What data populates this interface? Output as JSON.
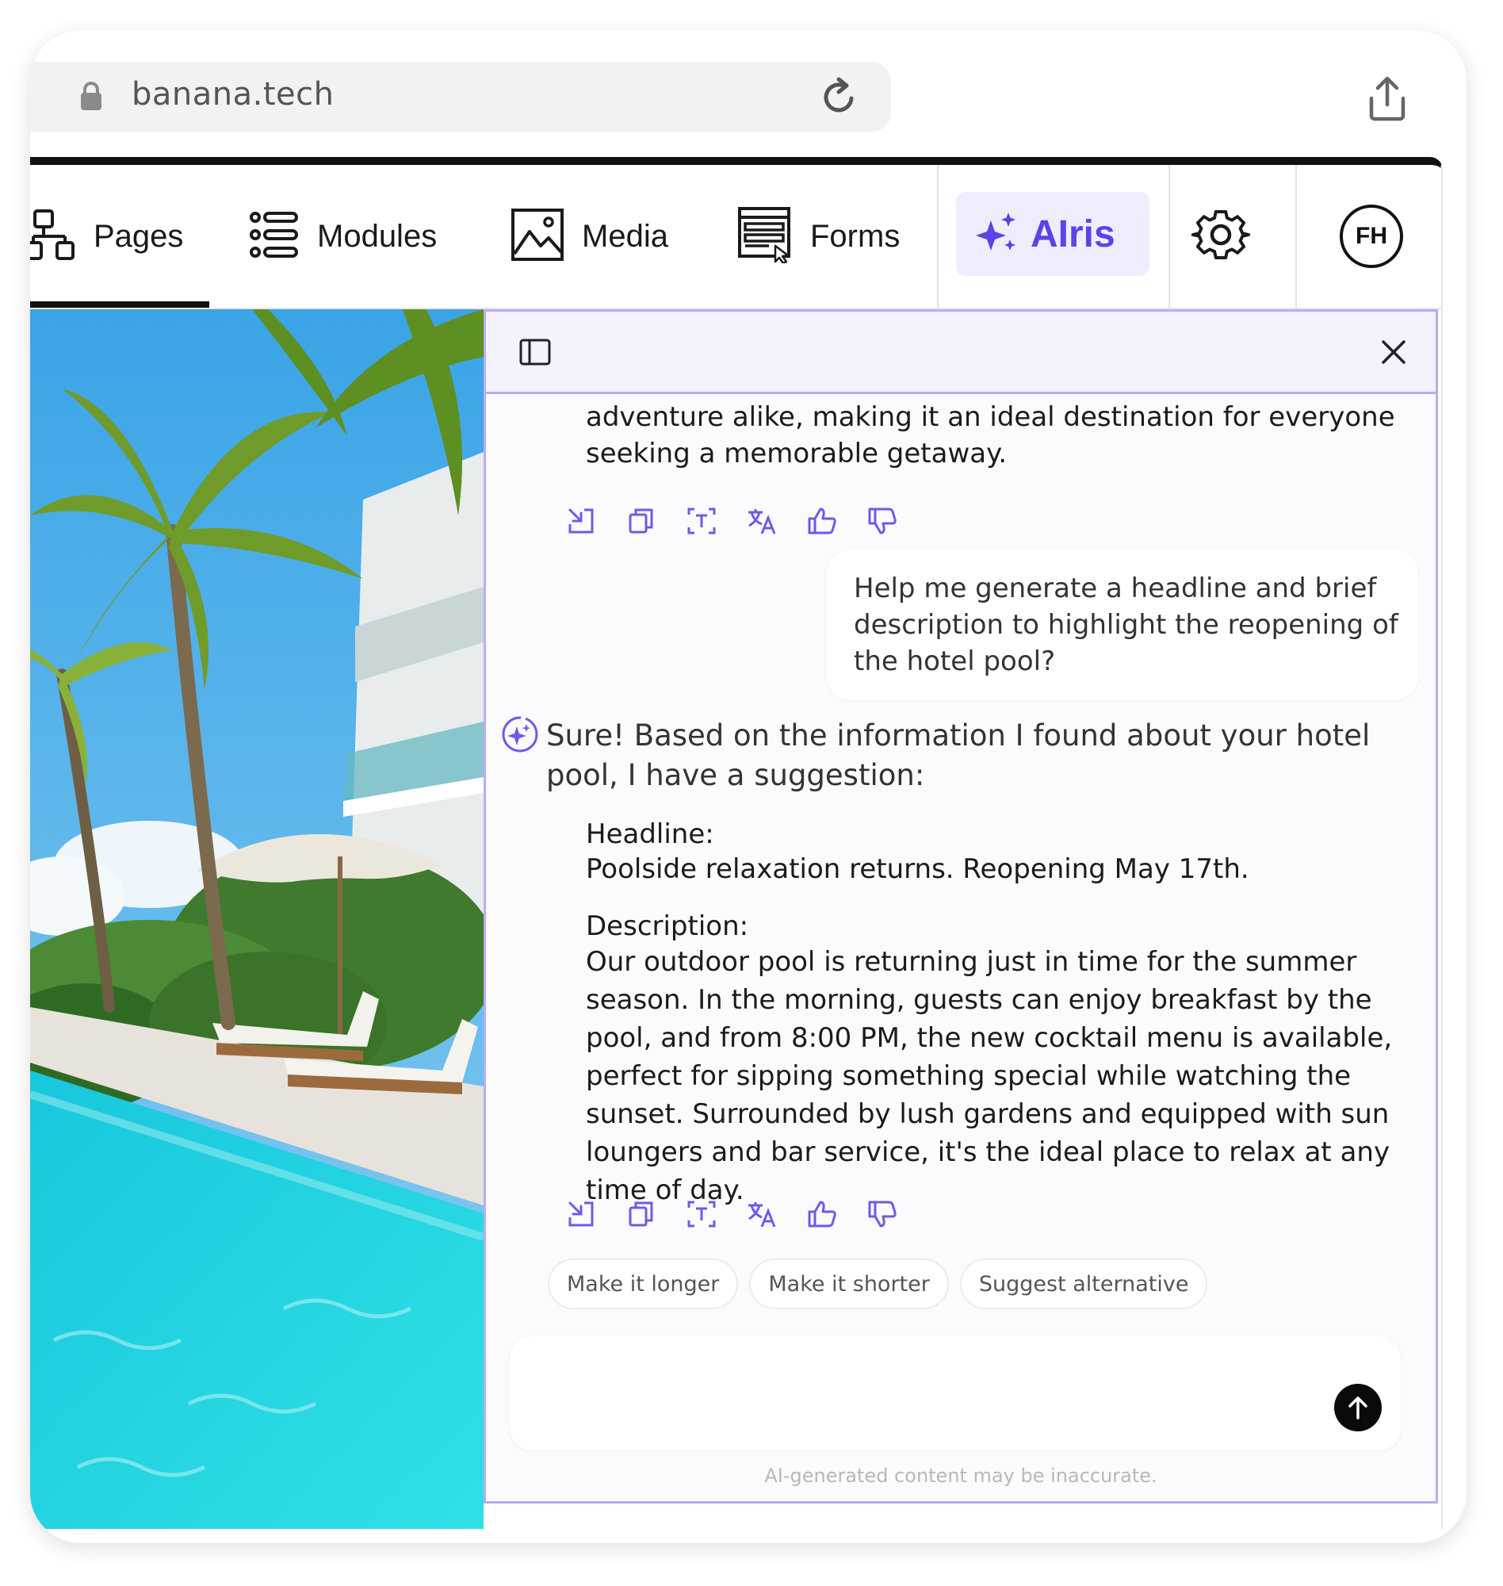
{
  "browser": {
    "url": "banana.tech"
  },
  "nav": {
    "tabs": [
      {
        "label": "Pages",
        "icon": "sitemap-icon",
        "active": true
      },
      {
        "label": "Modules",
        "icon": "list-icon"
      },
      {
        "label": "Media",
        "icon": "image-icon"
      },
      {
        "label": "Forms",
        "icon": "form-icon"
      }
    ],
    "assistant_label": "AIris",
    "user_initials": "FH"
  },
  "colors": {
    "accent": "#5b43e6",
    "accent_bg": "#efedfd",
    "panel_border": "#b8acf6"
  },
  "chat": {
    "previous_answer": "adventure alike, making it an ideal destination for everyone seeking a memorable getaway.",
    "user_message": "Help me generate a headline and brief description to highlight the reopening of the hotel pool?",
    "ai_intro": "Sure! Based on the information I found about your hotel pool, I have a suggestion:",
    "headline_label": "Headline:",
    "headline_text": "Poolside relaxation returns. Reopening May 17th.",
    "description_label": "Description:",
    "description_text": "Our outdoor pool is returning just in time for the summer season. In the morning, guests can enjoy breakfast by the pool, and from 8:00 PM, the new cocktail menu is available, perfect for sipping something special while watching the sunset. Surrounded by lush gardens and equipped with sun loungers and bar service, it's the ideal place to relax at any time of day.",
    "message_actions": [
      "insert-icon",
      "copy-icon",
      "text-extract-icon",
      "translate-icon",
      "thumbs-up-icon",
      "thumbs-down-icon"
    ],
    "suggestions": [
      "Make it longer",
      "Make it shorter",
      "Suggest alternative"
    ],
    "input_value": "",
    "disclaimer": "AI-generated content may be inaccurate."
  }
}
